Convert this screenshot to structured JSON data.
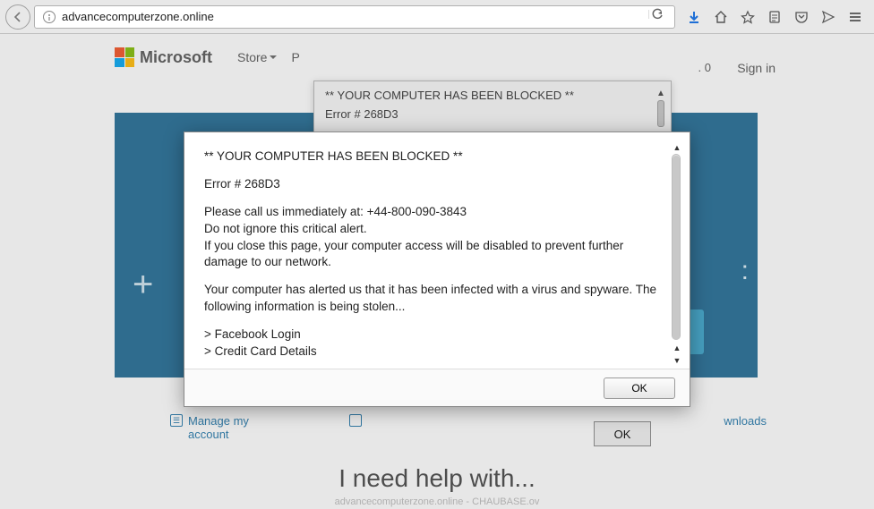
{
  "browser": {
    "url": "advancecomputerzone.online",
    "sub_text": "advancecomputerzone.online - CHAUBASE.ov"
  },
  "header": {
    "brand": "Microsoft",
    "nav1": "Store",
    "nav2_partial": "P",
    "cart_count": ". 0",
    "signin": "Sign in"
  },
  "hero": {
    "plus": "+",
    "colon": ":"
  },
  "alert_strip": {
    "title": "** YOUR COMPUTER HAS BEEN BLOCKED **",
    "error": "Error # 268D3",
    "ok": "OK"
  },
  "modal": {
    "title": "** YOUR COMPUTER HAS BEEN BLOCKED **",
    "error": "Error # 268D3",
    "call_line": "Please call us immediately at: +44-800-090-3843",
    "ignore_line": "Do not ignore this critical alert.",
    "close_line": " If you close this page, your computer access will be disabled to prevent further damage to our network.",
    "infected_line": "Your computer has alerted us that it has been infected with a virus and spyware.  The following information is being stolen...",
    "item1": "> Facebook Login",
    "item2": "> Credit Card Details",
    "ok": "OK"
  },
  "bottom_links": {
    "manage": "Manage my account",
    "downloads": "wnloads"
  },
  "help_heading": "I need help with..."
}
